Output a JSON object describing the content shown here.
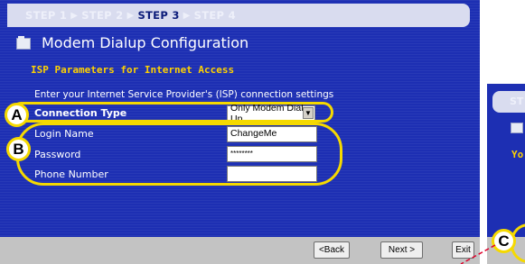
{
  "wizard": {
    "steps": [
      "STEP 1",
      "STEP 2",
      "STEP 3",
      "STEP 4"
    ],
    "active_step": "STEP 3",
    "title": "Modem Dialup Configuration",
    "section_title": "ISP Parameters for Internet Access",
    "intro": "Enter your Internet Service Provider's (ISP) connection settings"
  },
  "form": {
    "connection_type_label": "Connection Type",
    "connection_type_value": "Only Modem Dial Up",
    "login_name_label": "Login Name",
    "login_name_value": "ChangeMe",
    "password_label": "Password",
    "password_value": "********",
    "phone_number_label": "Phone Number",
    "phone_number_value": ""
  },
  "buttons": {
    "back": "<Back",
    "next": "Next >",
    "exit": "Exit"
  },
  "callouts": {
    "a": "A",
    "b": "B",
    "c": "C"
  },
  "overlay": {
    "step_text": "ST",
    "section_text": "Yo"
  },
  "colors": {
    "panel_bg": "#1d2fb3",
    "section_title": "#ffd200",
    "callout_ring": "#f5d900",
    "footer_bg": "#c3c3c3",
    "pointer_line": "#e0002a"
  }
}
